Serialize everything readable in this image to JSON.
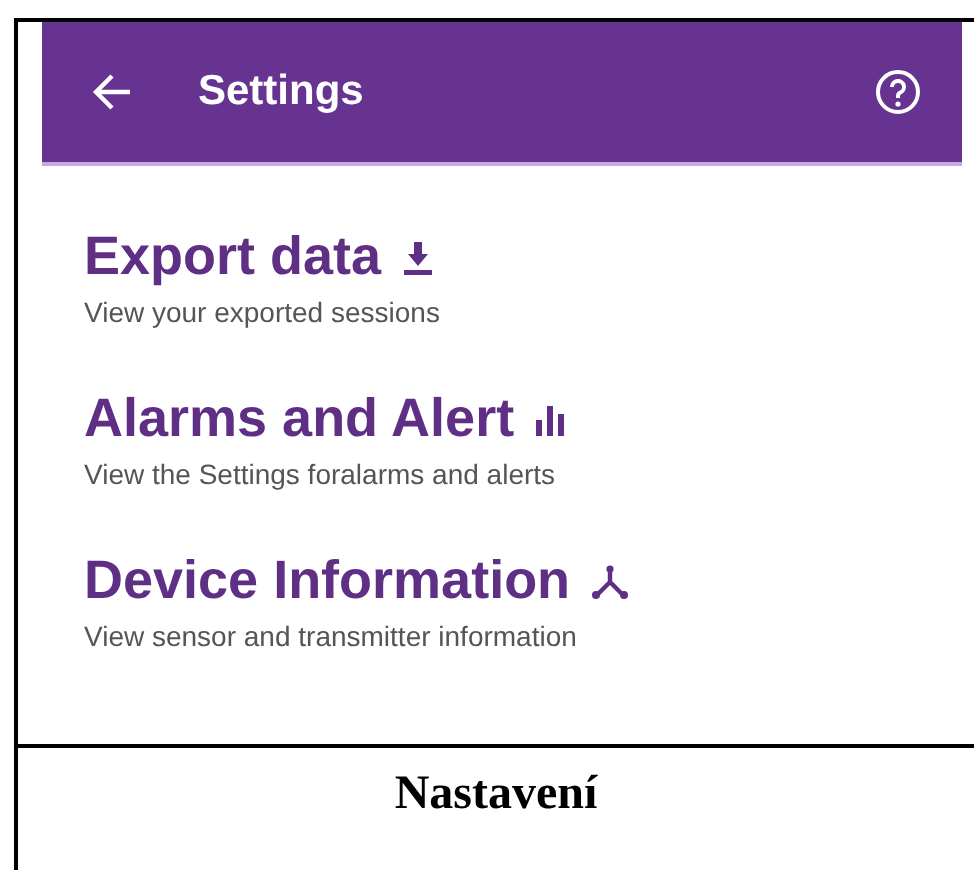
{
  "app_bar": {
    "title": "Settings"
  },
  "items": [
    {
      "title": "Export data",
      "subtitle": "View your exported sessions",
      "kind": "download"
    },
    {
      "title": "Alarms and Alert",
      "subtitle": "View the Settings foralarms and alerts",
      "kind": "bars"
    },
    {
      "title": "Device Information",
      "subtitle": "View sensor and transmitter information",
      "kind": "hub"
    }
  ],
  "caption": "Nastavení"
}
